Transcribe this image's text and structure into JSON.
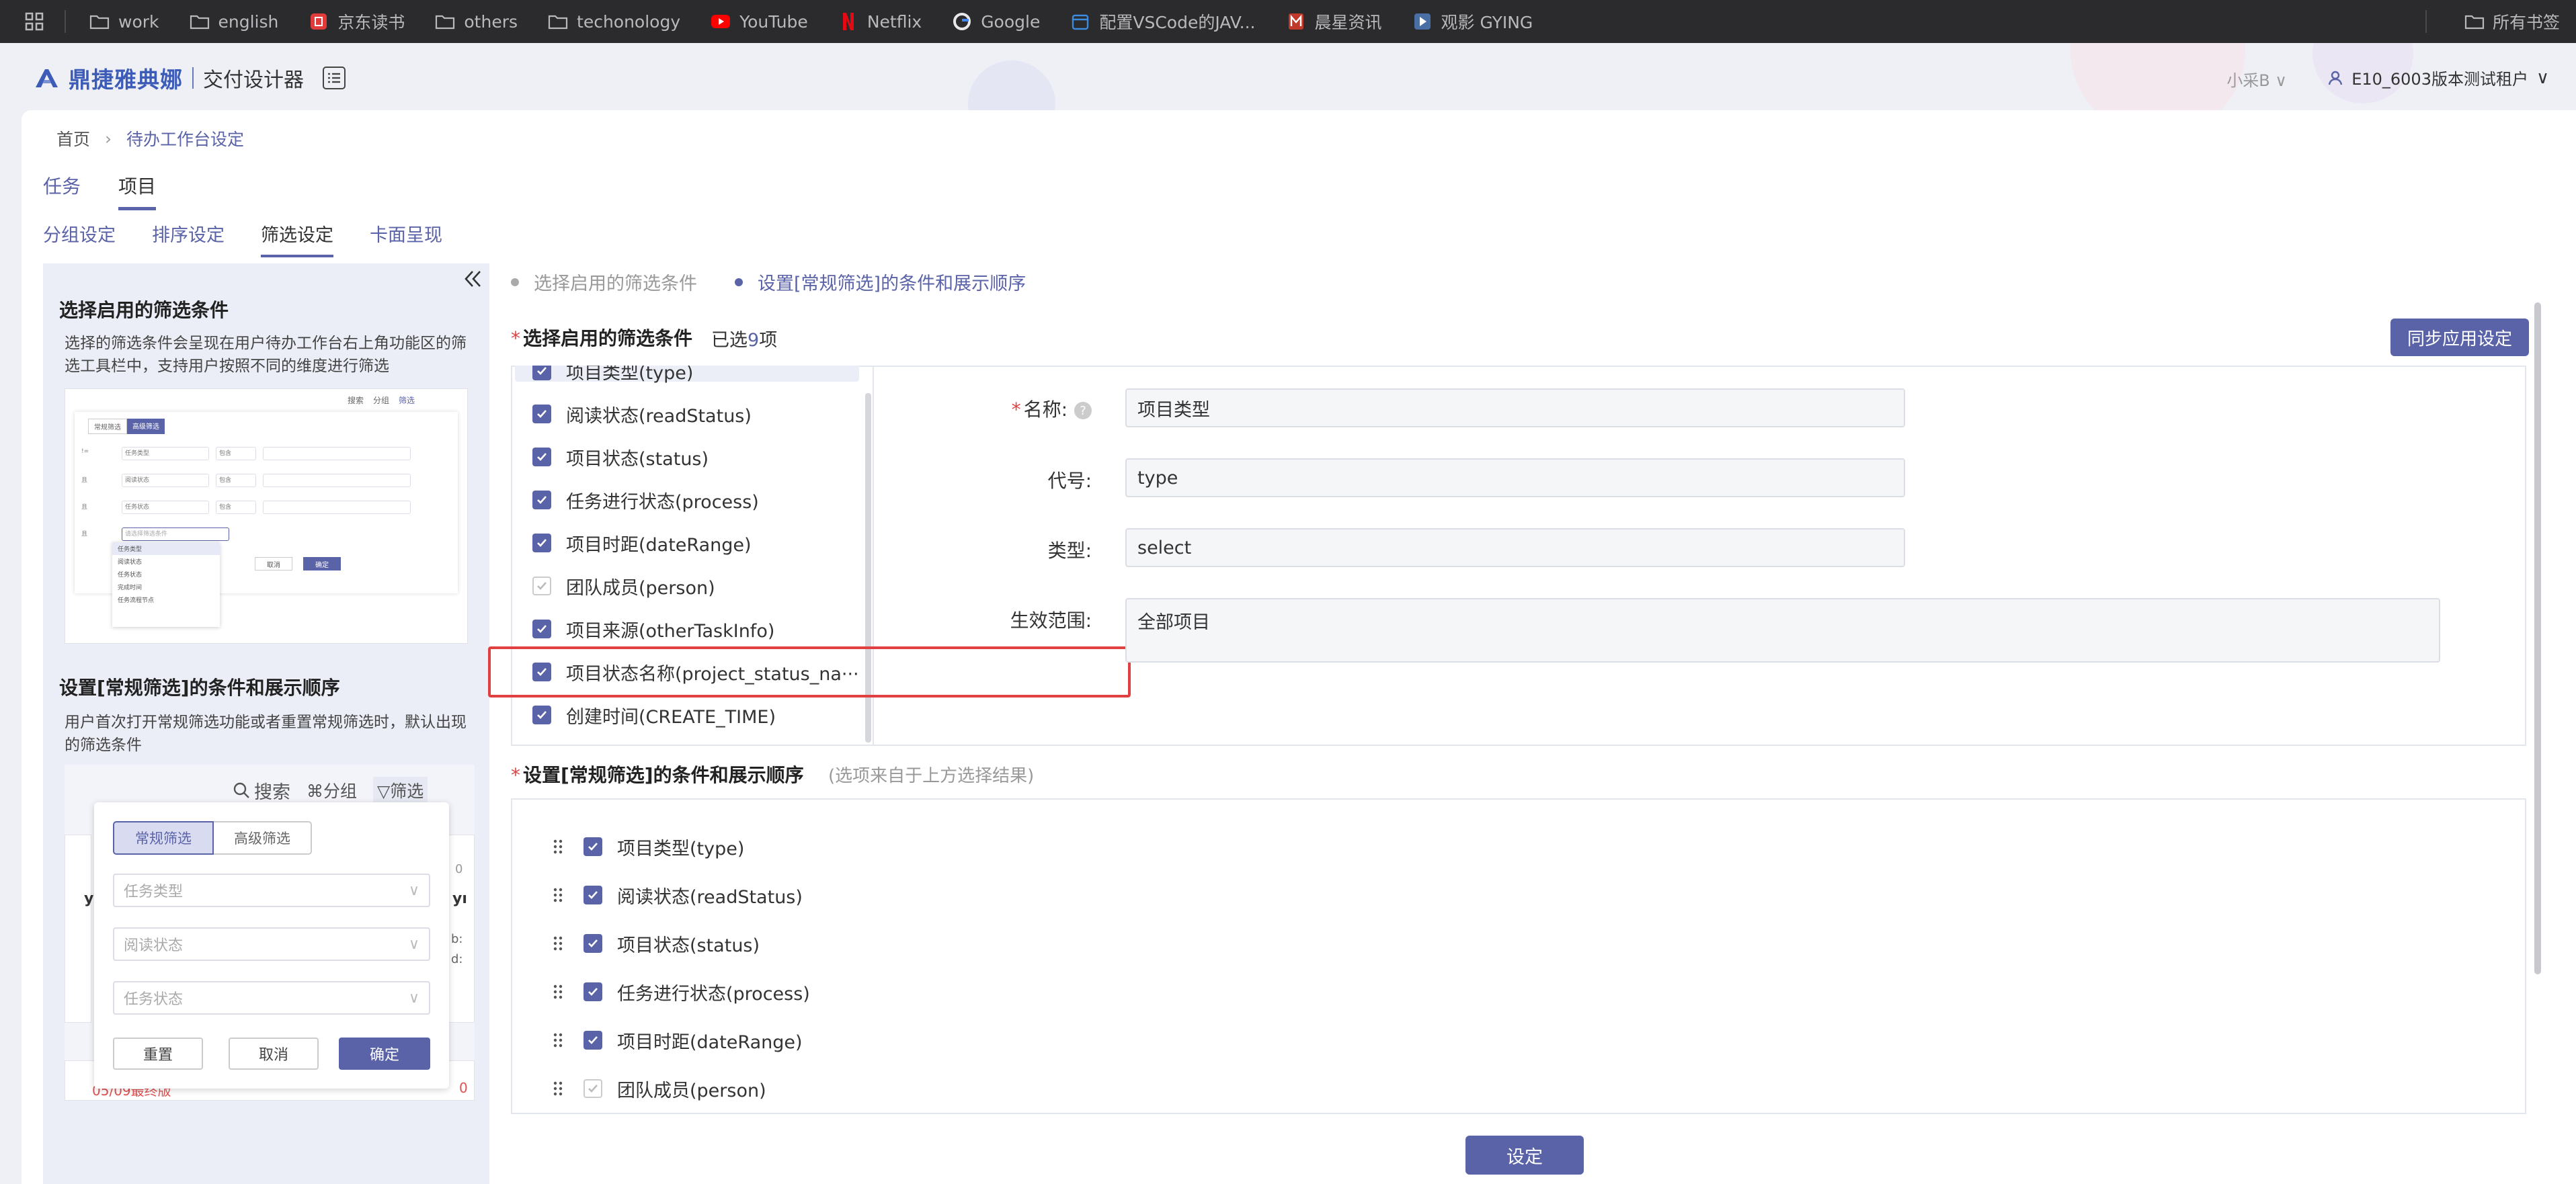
{
  "bookmarks": {
    "items": [
      {
        "label": "work",
        "icon": "folder-icon"
      },
      {
        "label": "english",
        "icon": "folder-icon"
      },
      {
        "label": "京东读书",
        "icon": "jd-icon"
      },
      {
        "label": "others",
        "icon": "folder-icon"
      },
      {
        "label": "techonology",
        "icon": "folder-icon"
      },
      {
        "label": "YouTube",
        "icon": "youtube-icon"
      },
      {
        "label": "Netflix",
        "icon": "netflix-icon"
      },
      {
        "label": "Google",
        "icon": "google-icon"
      },
      {
        "label": "配置VSCode的JAV...",
        "icon": "calendar-icon"
      },
      {
        "label": "晨星资讯",
        "icon": "m-icon"
      },
      {
        "label": "观影 GYING",
        "icon": "play-icon"
      }
    ],
    "all_bookmarks": "所有书签"
  },
  "header": {
    "logo_text": "鼎捷雅典娜",
    "subtitle": "交付设计器",
    "user_short": "小采B",
    "tenant": "E10_6003版本测试租户"
  },
  "breadcrumb": {
    "home": "首页",
    "current": "待办工作台设定"
  },
  "tabs_primary": [
    "任务",
    "项目"
  ],
  "tabs_secondary": [
    "分组设定",
    "排序设定",
    "筛选设定",
    "卡面呈现"
  ],
  "help": {
    "title1": "选择启用的筛选条件",
    "desc1": "选择的筛选条件会呈现在用户待办工作台右上角功能区的筛选工具栏中，支持用户按照不同的维度进行筛选",
    "title2": "设置[常规筛选]的条件和展示顺序",
    "desc2": "用户首次打开常规筛选功能或者重置常规筛选时，默认出现的筛选条件",
    "thumb1": {
      "search": "搜索",
      "group": "分组",
      "filter": "筛选",
      "tabs": [
        "常规筛选",
        "高级筛选"
      ],
      "rows": [
        [
          "任务类型",
          "包含"
        ],
        [
          "阅读状态",
          "包含"
        ],
        [
          "任务状态",
          "包含"
        ]
      ],
      "placeholder": "请选择筛选条件",
      "cancel": "取消",
      "ok": "确定",
      "options": [
        "任务类型",
        "阅读状态",
        "任务状态",
        "完成时间",
        "任务流程节点"
      ]
    },
    "thumb2": {
      "search": "搜索",
      "group": "分组",
      "filter": "筛选",
      "tab_basic": "常规筛选",
      "tab_adv": "高级筛选",
      "fields": [
        "任务类型",
        "阅读状态",
        "任务状态"
      ],
      "reset": "重置",
      "cancel": "取消",
      "ok": "确定",
      "bottom_text": "05/09最终版",
      "zero": "0"
    }
  },
  "steps": [
    "选择启用的筛选条件",
    "设置[常规筛选]的条件和展示顺序"
  ],
  "section1": {
    "title": "选择启用的筛选条件",
    "selected_prefix": "已选",
    "selected_count": "9",
    "selected_suffix": "项",
    "sync_button": "同步应用设定",
    "items": [
      {
        "label": "项目类型(type)",
        "checked": true
      },
      {
        "label": "阅读状态(readStatus)",
        "checked": true
      },
      {
        "label": "项目状态(status)",
        "checked": true
      },
      {
        "label": "任务进行状态(process)",
        "checked": true
      },
      {
        "label": "项目时距(dateRange)",
        "checked": true
      },
      {
        "label": "团队成员(person)",
        "checked": true,
        "disabled": true
      },
      {
        "label": "项目来源(otherTaskInfo)",
        "checked": true
      },
      {
        "label": "项目状态名称(project_status_na···",
        "checked": true
      },
      {
        "label": "创建时间(CREATE_TIME)",
        "checked": true
      }
    ],
    "form": {
      "name_label": "名称:",
      "name_value": "项目类型",
      "code_label": "代号:",
      "code_value": "type",
      "type_label": "类型:",
      "type_value": "select",
      "scope_label": "生效范围:",
      "scope_value": "全部项目"
    }
  },
  "section2": {
    "title": "设置[常规筛选]的条件和展示顺序",
    "hint": "(选项来自于上方选择结果)",
    "items": [
      {
        "label": "项目类型(type)",
        "disabled": false
      },
      {
        "label": "阅读状态(readStatus)",
        "disabled": false
      },
      {
        "label": "项目状态(status)",
        "disabled": false
      },
      {
        "label": "任务进行状态(process)",
        "disabled": false
      },
      {
        "label": "项目时距(dateRange)",
        "disabled": false
      },
      {
        "label": "团队成员(person)",
        "disabled": true
      }
    ]
  },
  "footer": {
    "set_button": "设定"
  },
  "colors": {
    "accent": "#5b63a8",
    "required": "#d44444",
    "highlight": "#e04040"
  }
}
